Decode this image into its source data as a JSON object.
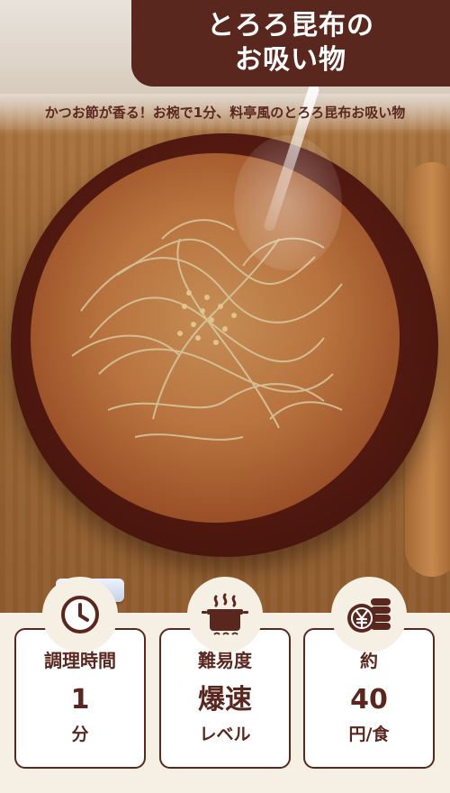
{
  "title": {
    "line1": "とろろ昆布の",
    "line2": "お吸い物"
  },
  "subtitle": "かつお節が香る！お椀で1分、料亭風のとろろ昆布お吸い物",
  "cards": [
    {
      "label": "調理時間",
      "value": "1",
      "unit": "分",
      "icon": "clock-icon"
    },
    {
      "label": "難易度",
      "value": "爆速",
      "unit": "レベル",
      "icon": "steaming-pot-icon"
    },
    {
      "label": "約",
      "value": "40",
      "unit": "円/食",
      "icon": "yen-coins-icon"
    }
  ],
  "colors": {
    "brand": "#5a271f",
    "panel_bg": "#f6efe4",
    "card_bg": "#ffffff"
  }
}
